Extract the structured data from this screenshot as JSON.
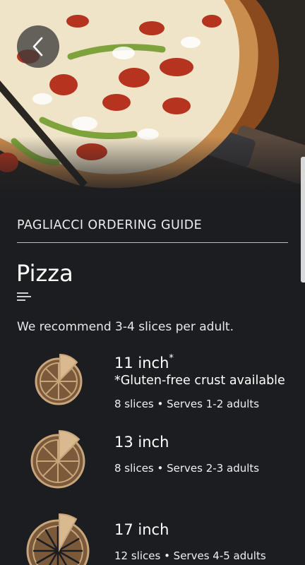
{
  "header": {
    "guide_title": "PAGLIACCI ORDERING GUIDE",
    "page_title": "Pizza",
    "recommendation": "We recommend 3-4 slices per adult."
  },
  "sizes": [
    {
      "name": "11 inch",
      "marker": "*",
      "note": "*Gluten-free crust available",
      "detail": "8 slices • Serves 1-2 adults",
      "slices": 8
    },
    {
      "name": "13 inch",
      "marker": "",
      "note": "",
      "detail": "8 slices • Serves 2-3 adults",
      "slices": 8
    },
    {
      "name": "17 inch",
      "marker": "",
      "note": "",
      "detail": "12 slices • Serves 4-5 adults",
      "slices": 12
    }
  ],
  "colors": {
    "background": "#1c1d21",
    "pizza_icon_outline": "#c9a57c",
    "pizza_icon_fill": "#7a5a3a",
    "pizza_icon_slice": "#d9b98f"
  },
  "icons": {
    "back": "chevron-left-icon",
    "menu": "list-icon"
  }
}
